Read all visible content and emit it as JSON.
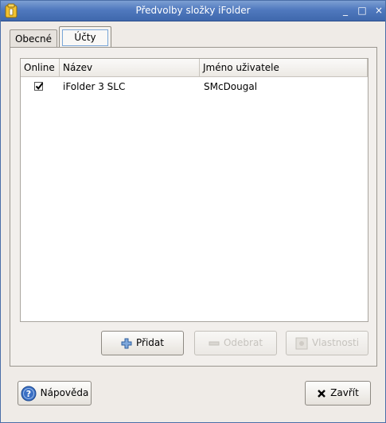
{
  "window": {
    "title": "Předvolby složky iFolder",
    "controls": {
      "minimize": "_",
      "maximize": "□",
      "close": "×"
    }
  },
  "tabs": [
    {
      "label": "Obecné",
      "selected": false
    },
    {
      "label": "Účty",
      "selected": true
    }
  ],
  "accounts_table": {
    "columns": [
      "Online",
      "Název",
      "Jméno uživatele"
    ],
    "rows": [
      {
        "online": true,
        "name": "iFolder 3 SLC",
        "user": "SMcDougal"
      }
    ]
  },
  "buttons": {
    "add": "Přidat",
    "remove": "Odebrat",
    "properties": "Vlastnosti",
    "help": "Nápověda",
    "close": "Zavřít"
  },
  "colors": {
    "titlebar": "#5079be",
    "accent": "#4a6ea8"
  }
}
